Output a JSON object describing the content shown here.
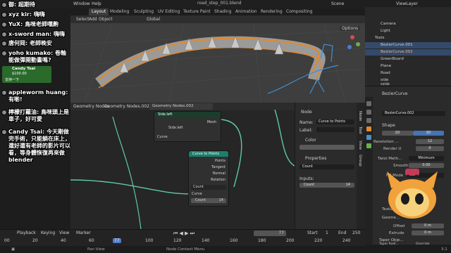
{
  "window": {
    "file_title": "road_step_001.blend",
    "scene": "Scene",
    "view_layer": "ViewLayer"
  },
  "top_menu": [
    "Window",
    "Help"
  ],
  "workspace_tabs": [
    "Layout",
    "Modeling",
    "Sculpting",
    "UV Editing",
    "Texture Paint",
    "Shading",
    "Animation",
    "Rendering",
    "Compositing"
  ],
  "viewport": {
    "menus": [
      "Select",
      "Add",
      "Object"
    ],
    "orientation": "Global",
    "options": "Options"
  },
  "node_editor": {
    "breadcrumb": [
      "Geometry Nodes",
      "Geometry Nodes.002"
    ],
    "header_name": "Geometry Nodes.002",
    "node_reroute": {
      "label": "Side.left",
      "sub_label": "Side.left",
      "out_socket": "Mesh",
      "curve_socket": "Curve"
    },
    "node_curve_to_points": {
      "title": "Curve to Points",
      "outputs": [
        "Points",
        "Tangent",
        "Normal",
        "Rotation"
      ],
      "mode": "Count",
      "input_curve": "Curve",
      "count_label": "Count",
      "count_value": "14"
    }
  },
  "npanel": {
    "section_node": "Node",
    "name_label": "Name:",
    "name_value": "Curve to Points",
    "label_label": "Label:",
    "section_color": "Color",
    "section_properties": "Properties",
    "mode_value": "Count",
    "inputs_label": "Inputs:",
    "count_label": "Count",
    "count_value": "14",
    "tabs": [
      "Node",
      "Tool",
      "View",
      "Group"
    ]
  },
  "outliner": {
    "items": [
      {
        "name": "Camera",
        "selected": false
      },
      {
        "name": "Light",
        "selected": false
      },
      {
        "name": "Tools",
        "selected": false
      },
      {
        "name": "BezierCurve.001",
        "selected": true
      },
      {
        "name": "BezierCurve.002",
        "selected": true
      },
      {
        "name": "GreenBoard",
        "selected": false
      },
      {
        "name": "Plane",
        "selected": false
      },
      {
        "name": "Road",
        "selected": false
      },
      {
        "name": "side",
        "selected": false
      },
      {
        "name": "sside",
        "selected": false
      }
    ]
  },
  "properties": {
    "object": "BezierCurve",
    "data": "BezierCurve.002",
    "shape_section": "Shape",
    "dims": [
      "2D",
      "3D"
    ],
    "resolution_label": "Resolution ...",
    "resolution_value": "12",
    "render_u_label": "Render U",
    "render_u_value": "0",
    "twist_label": "Twist Meth...",
    "twist_value": "Minimum",
    "smooth_label": "Smooth",
    "smooth_value": "0.00",
    "fill_label": "Fill Mode",
    "texture_label": "Textu...",
    "geometry_label": "Geome...",
    "offset_label": "Offset",
    "offset_value": "0 m",
    "extrude_label": "Extrude",
    "extrude_value": "0 m",
    "taper_obj_label": "Taper Obje...",
    "taper_radius_label": "Taper Radi...",
    "taper_radius_value": "Override"
  },
  "timeline": {
    "menus": [
      "Playback",
      "Keying",
      "View",
      "Marker"
    ],
    "current_frame": "77",
    "start_label": "Start",
    "start_value": "1",
    "end_label": "End",
    "end_value": "250",
    "ticks": [
      "00",
      "20",
      "40",
      "60",
      "77",
      "100",
      "120",
      "140",
      "160",
      "180",
      "200",
      "220",
      "240"
    ]
  },
  "statusbar": {
    "pan_view": "Pan View",
    "node_context": "Node Context Menu",
    "version": "3.1"
  },
  "chat": [
    {
      "user": "御",
      "text": "超期待"
    },
    {
      "user": "xyz kir",
      "text": "嗨嗨"
    },
    {
      "user": "YuX",
      "text": "鳥咪老師嘿齁"
    },
    {
      "user": "x-sword man",
      "text": "嗨嗨"
    },
    {
      "user": "唐何岡",
      "text": "老師晚安"
    },
    {
      "user": "yoho kumako",
      "text": "卷軸能做彈開動畫嗎?"
    },
    {
      "user": "appleworm huang",
      "text": "有喲!"
    },
    {
      "user": "檸檬打蘿油",
      "text": "鳥咪頭上是車子，好可愛"
    },
    {
      "user": "Candy Tsai",
      "text": "今天剛做完手術，只能躺在床上，還好還有老師的影片可以看，等身體恢復再來做blender"
    }
  ],
  "donation": {
    "user": "Candy Tsai",
    "amount": "$100.00",
    "message": "支持一下"
  },
  "colors": {
    "accent_blue": "#4772b3",
    "node_green": "#1a7f6e",
    "node_teal": "#2a9d8f",
    "selection": "#334a6b",
    "playhead": "#4e7ac8"
  }
}
